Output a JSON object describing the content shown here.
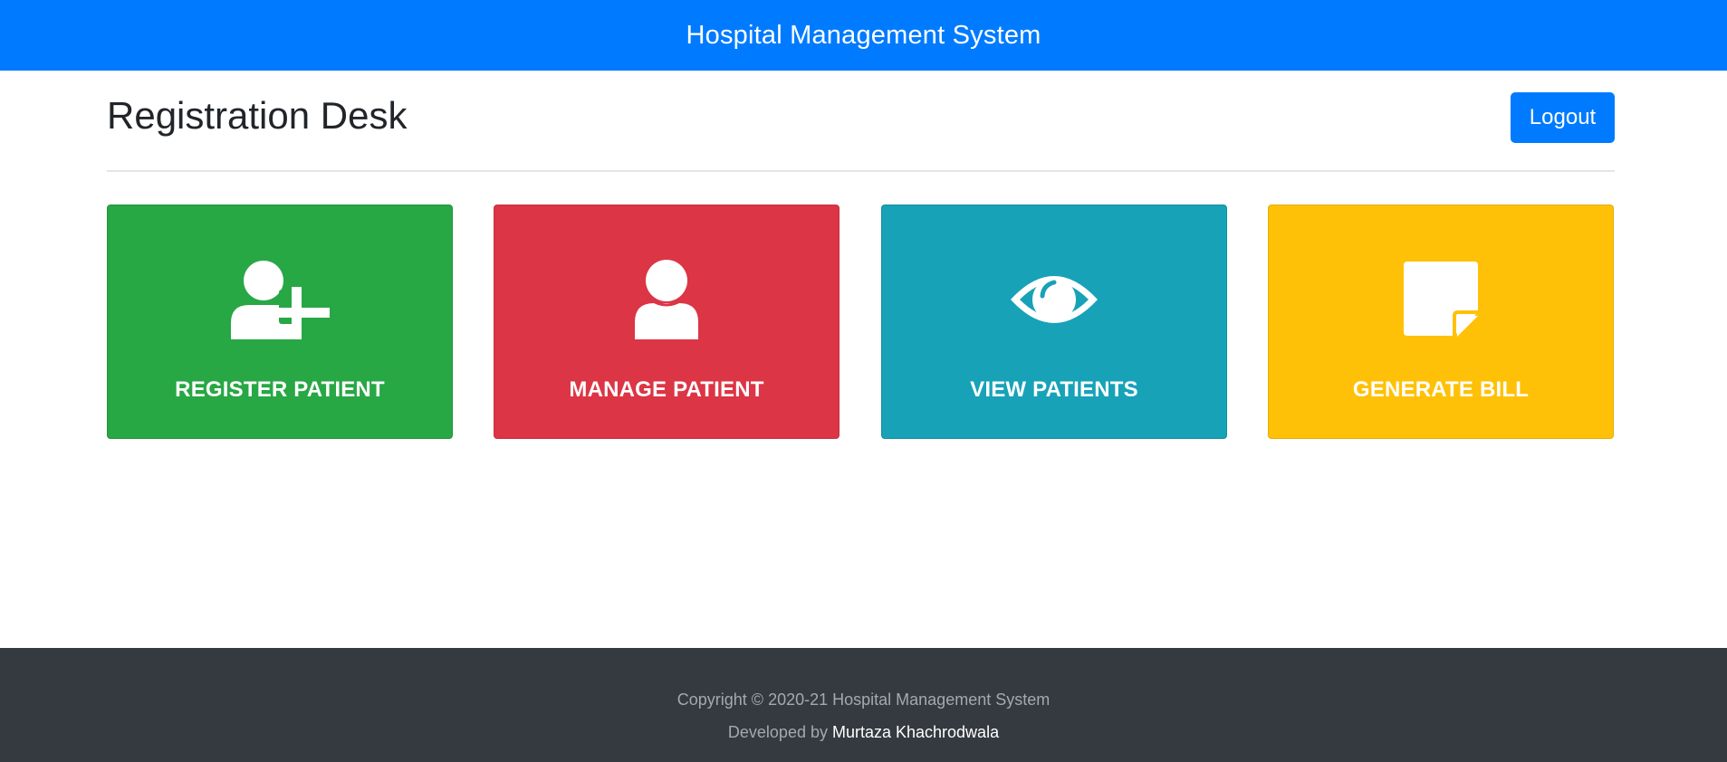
{
  "navbar": {
    "brand": "Hospital Management System",
    "color": "#007bff"
  },
  "header": {
    "title": "Registration Desk",
    "logout_label": "Logout"
  },
  "cards": [
    {
      "label": "REGISTER PATIENT",
      "icon": "user-plus-icon",
      "color": "#28a745"
    },
    {
      "label": "MANAGE PATIENT",
      "icon": "user-icon",
      "color": "#dc3545"
    },
    {
      "label": "VIEW PATIENTS",
      "icon": "eye-icon",
      "color": "#17a2b8"
    },
    {
      "label": "GENERATE BILL",
      "icon": "sticky-note-icon",
      "color": "#ffc107"
    }
  ],
  "footer": {
    "copyright": "Copyright © 2020-21 Hospital Management System",
    "developed_by_prefix": "Developed by",
    "developer_name": "Murtaza Khachrodwala",
    "background": "#343a40"
  }
}
